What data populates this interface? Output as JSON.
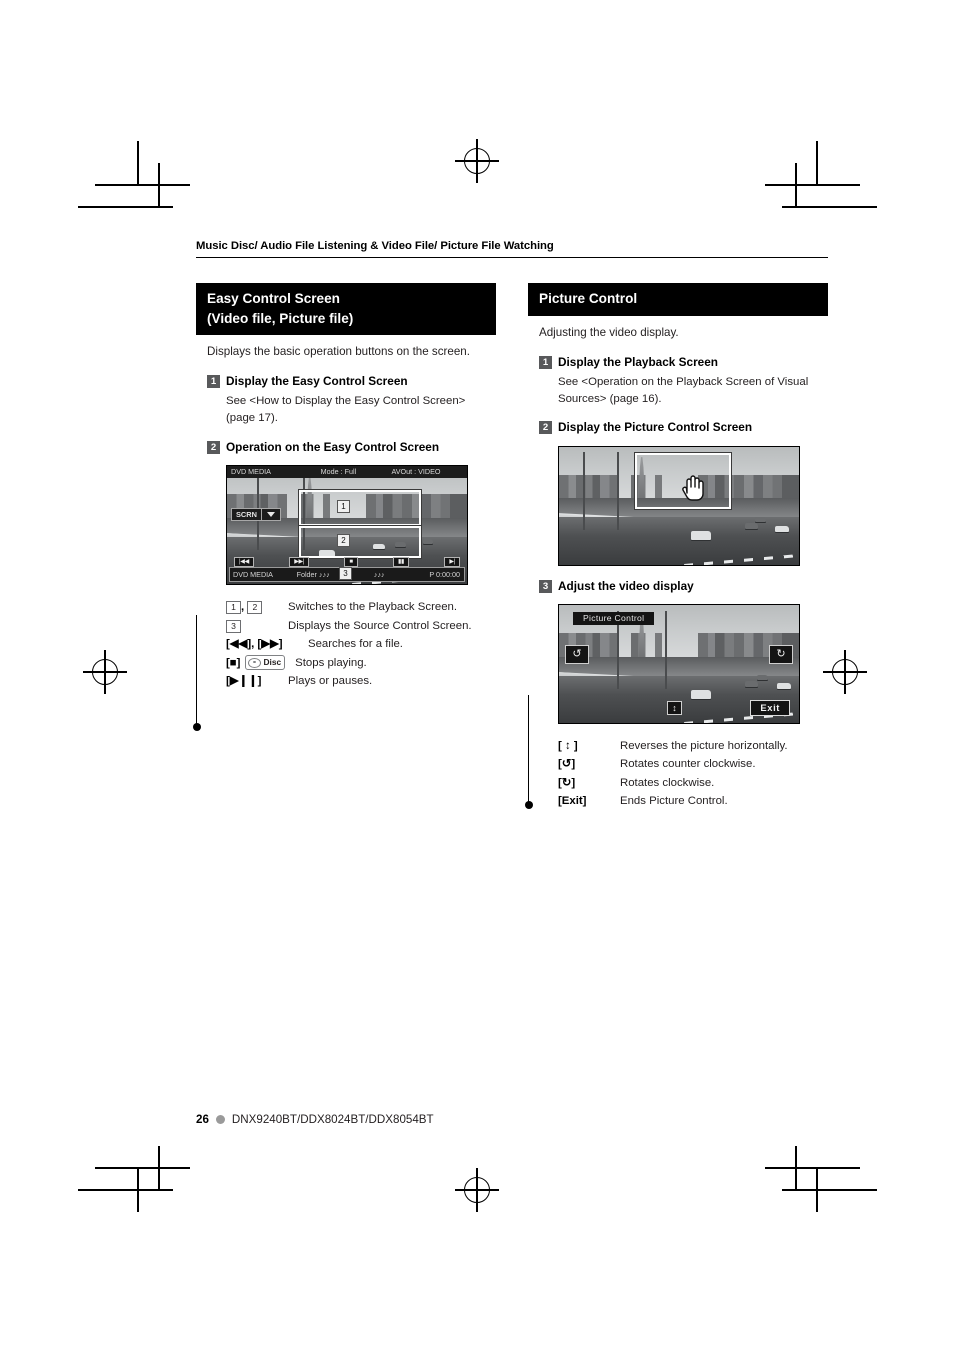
{
  "running_head": "Music Disc/ Audio File Listening & Video File/ Picture File Watching",
  "left_column": {
    "section_title_line1": "Easy Control Screen",
    "section_title_line2": "(Video file, Picture file)",
    "intro": "Displays the basic operation buttons on the screen.",
    "steps": [
      {
        "num": "1",
        "title": "Display the Easy Control Screen",
        "body": "See <How to Display the Easy Control Screen> (page 17)."
      },
      {
        "num": "2",
        "title": "Operation on the Easy Control Screen",
        "body": ""
      }
    ],
    "screenshot": {
      "topbar": {
        "source": "DVD MEDIA",
        "mode": "Mode : Full",
        "avout": "AVOut : VIDEO"
      },
      "scrn_button": "SCRN",
      "callouts": [
        "1",
        "2",
        "3"
      ],
      "transport_buttons": [
        "|◀◀",
        "▶▶|",
        "■",
        "▮▮",
        "▶|"
      ],
      "bottombar": {
        "source": "DVD MEDIA",
        "folder": "Folder ♪♪♪",
        "file": "♪♪♪",
        "time": "P  0:00:00"
      }
    },
    "legend": [
      {
        "key_badges": [
          "1",
          "2"
        ],
        "key_text": "",
        "desc": "Switches to the Playback Screen."
      },
      {
        "key_badges": [
          "3"
        ],
        "key_text": "",
        "desc": "Displays the Source Control Screen."
      },
      {
        "key_badges": [],
        "key_text": "[◀◀], [▶▶]",
        "desc": "Searches for a file."
      },
      {
        "key_badges": [],
        "key_text": "[■]",
        "chip": "Disc",
        "desc": "Stops playing."
      },
      {
        "key_badges": [],
        "key_text": "[▶❙❙]",
        "desc": "Plays or pauses."
      }
    ]
  },
  "right_column": {
    "section_title": "Picture Control",
    "intro": "Adjusting the video display.",
    "steps": [
      {
        "num": "1",
        "title": "Display the Playback Screen",
        "body": "See <Operation on the Playback Screen of Visual Sources> (page 16)."
      },
      {
        "num": "2",
        "title": "Display the Picture Control Screen",
        "body": ""
      },
      {
        "num": "3",
        "title": "Adjust the video display",
        "body": ""
      }
    ],
    "picture_control_screen": {
      "title": "Picture Control",
      "rotate_ccw": "↺",
      "rotate_cw": "↻",
      "flip": "↕",
      "exit": "Exit"
    },
    "legend": [
      {
        "key_text": "[ ↕ ]",
        "desc": "Reverses the picture horizontally."
      },
      {
        "key_text": "[↺]",
        "desc": "Rotates counter clockwise."
      },
      {
        "key_text": "[↻]",
        "desc": "Rotates clockwise."
      },
      {
        "key_text": "[Exit]",
        "desc": "Ends Picture Control."
      }
    ]
  },
  "footer": {
    "page_number": "26",
    "models": "DNX9240BT/DDX8024BT/DDX8054BT"
  }
}
